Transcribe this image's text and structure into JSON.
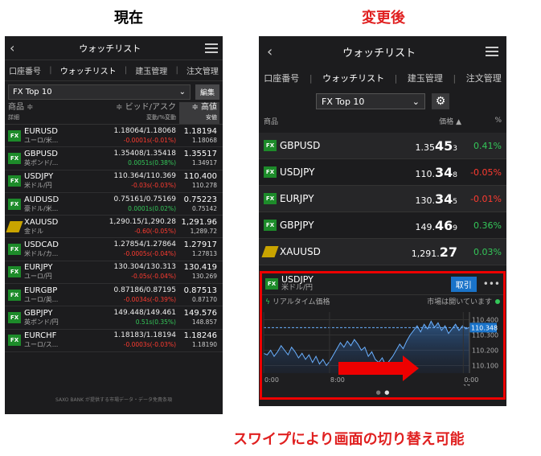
{
  "labels": {
    "current": "現在",
    "after": "変更後",
    "swipe": "スワイプにより画面の切り替え可能"
  },
  "left": {
    "title": "ウォッチリスト",
    "tabs": [
      "口座番号",
      "ウォッチリスト",
      "建玉管理",
      "注文管理"
    ],
    "list_name": "FX Top 10",
    "edit": "編集",
    "col_name": "商品 ≑",
    "col_name_sub": "詳細",
    "col_bid": "≑ ビッド/アスク",
    "col_bid_sub": "変動/%変動",
    "col_high": "≑ 高値",
    "col_high_sub": "安値",
    "rows": [
      {
        "icon": "fx",
        "name": "EURUSD",
        "sub": "ユーロ/米...",
        "bidask": "1.18064/1.18068",
        "chg": "-0.0001s(-0.01%)",
        "dir": "dn",
        "high": "1.18194",
        "low": "1.18068"
      },
      {
        "icon": "fx",
        "name": "GBPUSD",
        "sub": "英ポンド/...",
        "bidask": "1.35408/1.35418",
        "chg": "0.0051s(0.38%)",
        "dir": "up",
        "high": "1.35517",
        "low": "1.34917"
      },
      {
        "icon": "fx",
        "name": "USDJPY",
        "sub": "米ドル/円",
        "bidask": "110.364/110.369",
        "chg": "-0.03s(-0.03%)",
        "dir": "dn",
        "high": "110.400",
        "low": "110.278"
      },
      {
        "icon": "fx",
        "name": "AUDUSD",
        "sub": "豪ドル/米...",
        "bidask": "0.75161/0.75169",
        "chg": "0.0001s(0.02%)",
        "dir": "up",
        "high": "0.75223",
        "low": "0.75142"
      },
      {
        "icon": "gold",
        "name": "XAUUSD",
        "sub": "金ドル",
        "bidask": "1,290.15/1,290.28",
        "chg": "-0.60(-0.05%)",
        "dir": "dn",
        "high": "1,291.96",
        "low": "1,289.72"
      },
      {
        "icon": "fx",
        "name": "USDCAD",
        "sub": "米ドル/カ...",
        "bidask": "1.27854/1.27864",
        "chg": "-0.0005s(-0.04%)",
        "dir": "dn",
        "high": "1.27917",
        "low": "1.27813"
      },
      {
        "icon": "fx",
        "name": "EURJPY",
        "sub": "ユーロ/円",
        "bidask": "130.304/130.313",
        "chg": "-0.05s(-0.04%)",
        "dir": "dn",
        "high": "130.419",
        "low": "130.269"
      },
      {
        "icon": "fx",
        "name": "EURGBP",
        "sub": "ユーロ/英...",
        "bidask": "0.87186/0.87195",
        "chg": "-0.0034s(-0.39%)",
        "dir": "dn",
        "high": "0.87513",
        "low": "0.87170"
      },
      {
        "icon": "fx",
        "name": "GBPJPY",
        "sub": "英ポンド/円",
        "bidask": "149.448/149.461",
        "chg": "0.51s(0.35%)",
        "dir": "up",
        "high": "149.576",
        "low": "148.857"
      },
      {
        "icon": "fx",
        "name": "EURCHF",
        "sub": "ユーロ/ス...",
        "bidask": "1.18183/1.18194",
        "chg": "-0.0003s(-0.03%)",
        "dir": "dn",
        "high": "1.18246",
        "low": "1.18190"
      }
    ],
    "footer": "SAXO BANK が提供する市場データ・データ免責条項"
  },
  "right": {
    "title": "ウォッチリスト",
    "tabs": [
      "口座番号",
      "ウォッチリスト",
      "建玉管理",
      "注文管理"
    ],
    "list_name": "FX Top 10",
    "col_name": "商品",
    "col_price": "価格 ▲",
    "col_pct": "%",
    "rows": [
      {
        "icon": "fx",
        "name": "GBPUSD",
        "p1": "1.35",
        "p2": "45",
        "p3": "3",
        "chg": "0.41%",
        "dir": "up"
      },
      {
        "icon": "fx",
        "name": "USDJPY",
        "p1": "110.",
        "p2": "34",
        "p3": "8",
        "chg": "-0.05%",
        "dir": "dn"
      },
      {
        "icon": "fx",
        "name": "EURJPY",
        "p1": "130.",
        "p2": "34",
        "p3": "5",
        "chg": "-0.01%",
        "dir": "dn"
      },
      {
        "icon": "fx",
        "name": "GBPJPY",
        "p1": "149.",
        "p2": "46",
        "p3": "9",
        "chg": "0.36%",
        "dir": "up"
      },
      {
        "icon": "gold",
        "name": "XAUUSD",
        "p1": "1,291.",
        "p2": "27",
        "p3": "",
        "chg": "0.03%",
        "dir": "up"
      }
    ],
    "card": {
      "name": "USDJPY",
      "sub": "米ドル/円",
      "trade": "取引",
      "dots": "•••",
      "realtime": "リアルタイム価格",
      "market": "市場は開いています",
      "y_ticks": [
        "110.400",
        "110.300",
        "110.200",
        "110.100"
      ],
      "current": "110.348",
      "x_ticks": [
        "0:00",
        "8:00",
        "0:00"
      ],
      "x_extra": "17",
      "series": [
        110.18,
        110.17,
        110.2,
        110.16,
        110.19,
        110.23,
        110.2,
        110.17,
        110.22,
        110.19,
        110.15,
        110.18,
        110.14,
        110.17,
        110.12,
        110.16,
        110.11,
        110.14,
        110.1,
        110.13,
        110.17,
        110.21,
        110.25,
        110.22,
        110.26,
        110.23,
        110.27,
        110.24,
        110.2,
        110.22,
        110.16,
        110.19,
        110.14,
        110.12,
        110.15,
        110.1,
        110.13,
        110.16,
        110.2,
        110.24,
        110.21,
        110.26,
        110.3,
        110.33,
        110.36,
        110.32,
        110.37,
        110.34,
        110.39,
        110.35,
        110.38,
        110.33,
        110.36,
        110.31,
        110.34,
        110.37,
        110.33,
        110.36,
        110.34,
        110.35
      ]
    }
  },
  "colors": {
    "up": "#34c759",
    "down": "#ff3b30",
    "accent": "#1a73c9",
    "red": "#e02020"
  }
}
